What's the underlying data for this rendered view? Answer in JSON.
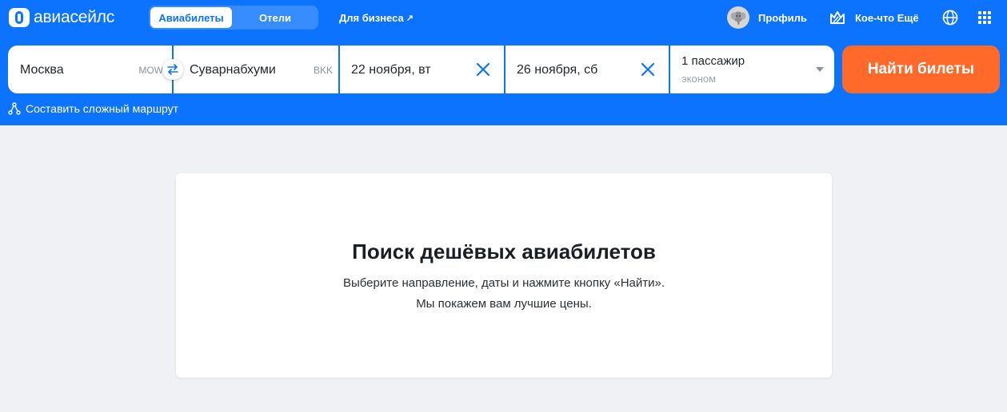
{
  "header": {
    "logo_text": "авиасейлс",
    "tabs": [
      {
        "label": "Авиабилеты",
        "active": true
      },
      {
        "label": "Отели",
        "active": false
      }
    ],
    "business_link": "Для бизнеса",
    "profile_label": "Профиль",
    "more_label": "Кое-что Ещё",
    "icons": [
      "logo-icon",
      "arrow-up-right-icon",
      "elephant-avatar",
      "more-icon",
      "globe-icon",
      "apps-grid-icon"
    ]
  },
  "search_form": {
    "origin": {
      "value": "Москва",
      "code": "MOW"
    },
    "destination": {
      "value": "Суварнабхуми",
      "code": "BKK"
    },
    "depart_date": "22 ноября, вт",
    "return_date": "26 ноября, сб",
    "passengers": "1 пассажир",
    "cabin_class": "эконом",
    "search_button": "Найти билеты",
    "complex_route": "Составить сложный маршрут"
  },
  "main": {
    "title": "Поиск дешёвых авиабилетов",
    "line1": "Выберите направление, даты и нажмите кнопку «Найти».",
    "line2": "Мы покажем вам лучшие цены."
  },
  "colors": {
    "brand_blue": "#0c73fe",
    "search_orange": "#ff6a2b",
    "page_bg": "#eff1f4"
  }
}
